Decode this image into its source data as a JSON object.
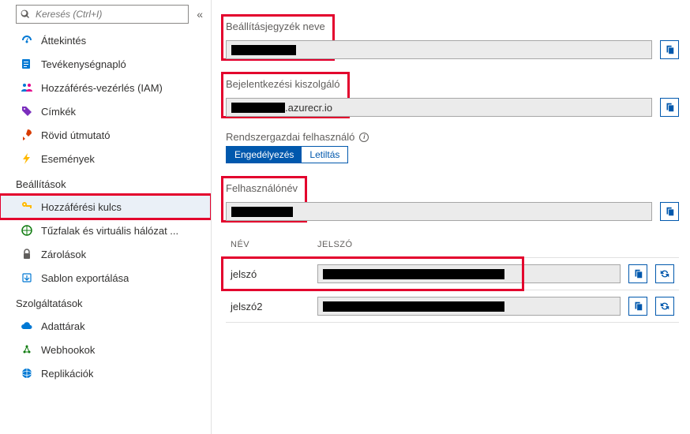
{
  "search": {
    "placeholder": "Keresés (Ctrl+I)"
  },
  "nav": {
    "items_top": [
      {
        "label": "Áttekintés"
      },
      {
        "label": "Tevékenységnapló"
      },
      {
        "label": "Hozzáférés-vezérlés (IAM)"
      },
      {
        "label": "Címkék"
      },
      {
        "label": "Rövid útmutató"
      },
      {
        "label": "Események"
      }
    ],
    "section_settings": "Beállítások",
    "items_settings": [
      {
        "label": "Hozzáférési kulcs"
      },
      {
        "label": "Tűzfalak és virtuális hálózat ..."
      },
      {
        "label": "Zárolások"
      },
      {
        "label": "Sablon exportálása"
      }
    ],
    "section_services": "Szolgáltatások",
    "items_services": [
      {
        "label": "Adattárak"
      },
      {
        "label": "Webhookok"
      },
      {
        "label": "Replikációk"
      }
    ]
  },
  "main": {
    "registry_name_label": "Beállításjegyzék neve",
    "registry_name_value": "",
    "login_server_label": "Bejelentkezési kiszolgáló",
    "login_server_suffix": ".azurecr.io",
    "admin_user_label": "Rendszergazdai felhasználó",
    "toggle_enable": "Engedélyezés",
    "toggle_disable": "Letiltás",
    "username_label": "Felhasználónév",
    "username_value": "",
    "table": {
      "col_name": "NÉV",
      "col_password": "JELSZÓ",
      "rows": [
        {
          "name": "jelszó"
        },
        {
          "name": "jelszó2"
        }
      ]
    }
  }
}
